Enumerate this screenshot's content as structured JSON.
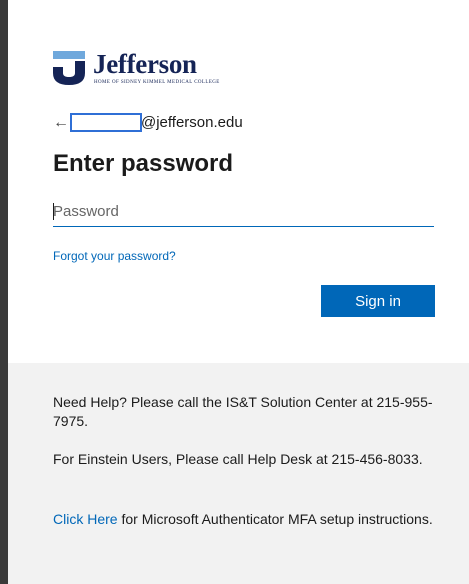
{
  "logo": {
    "name": "Jefferson",
    "tagline": "HOME OF SIDNEY KIMMEL MEDICAL COLLEGE",
    "brand_color": "#152456"
  },
  "identity": {
    "back_icon": "arrow-left-icon",
    "back_glyph": "←",
    "email_suffix": "@jefferson.edu"
  },
  "heading": "Enter password",
  "password_field": {
    "placeholder": "Password",
    "value": ""
  },
  "forgot_link": "Forgot your password?",
  "signin_button": "Sign in",
  "help": {
    "line1": "Need Help? Please call the IS&T Solution Center at 215-955-7975.",
    "line2": "For Einstein Users, Please call Help Desk at 215-456-8033.",
    "link_text": "Click Here",
    "line3_rest": " for Microsoft Authenticator MFA setup instructions."
  },
  "colors": {
    "accent": "#0067b8",
    "help_bg": "#f2f2f2"
  }
}
